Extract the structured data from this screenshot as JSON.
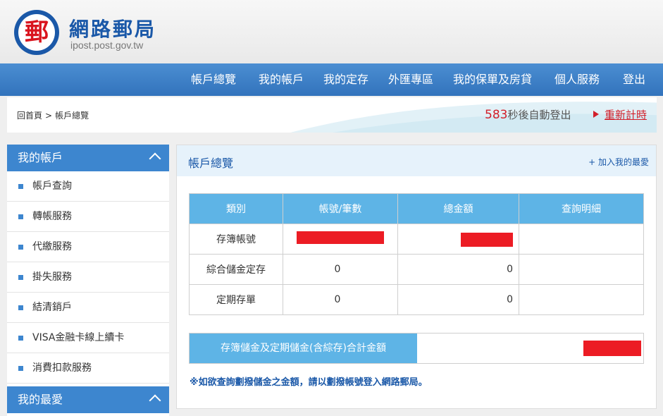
{
  "brand": {
    "logo_glyph": "郵",
    "title": "網路郵局",
    "subtitle": "ipost.post.gov.tw"
  },
  "nav": {
    "items": [
      "帳戶總覽",
      "我的帳戶",
      "我的定存",
      "外匯專區",
      "我的保單及房貸",
      "個人服務",
      "登出"
    ]
  },
  "breadcrumb": {
    "home": "回首頁",
    "separator": ">",
    "current": "帳戶總覽"
  },
  "session": {
    "seconds": "583",
    "suffix": "秒後自動登出",
    "renew_label": "重新計時"
  },
  "sidebar": {
    "sections": [
      {
        "title": "我的帳戶",
        "items": [
          "帳戶查詢",
          "轉帳服務",
          "代繳服務",
          "掛失服務",
          "結清銷戶",
          "VISA金融卡線上續卡",
          "消費扣款服務"
        ]
      },
      {
        "title": "我的最愛",
        "items": []
      }
    ]
  },
  "main": {
    "title": "帳戶總覽",
    "add_favorite": "+ 加入我的最愛",
    "table": {
      "headers": [
        "類別",
        "帳號/筆數",
        "總金額",
        "查詢明細"
      ],
      "rows": [
        {
          "category": "存簿帳號",
          "count": "",
          "amount": "",
          "detail": ""
        },
        {
          "category": "綜合儲金定存",
          "count": "0",
          "amount": "0",
          "detail": ""
        },
        {
          "category": "定期存單",
          "count": "0",
          "amount": "0",
          "detail": ""
        }
      ]
    },
    "total_label": "存簿儲金及定期儲金(含綜存)合計金額",
    "note": "※如欲查詢劃撥儲金之金額，請以劃撥帳號登入網路郵局。"
  },
  "colors": {
    "brand_blue": "#1a58a8",
    "nav_blue": "#3d86cf",
    "table_header": "#5eb4e6",
    "alert_red": "#d21f2a",
    "redaction": "#ec1c24"
  }
}
